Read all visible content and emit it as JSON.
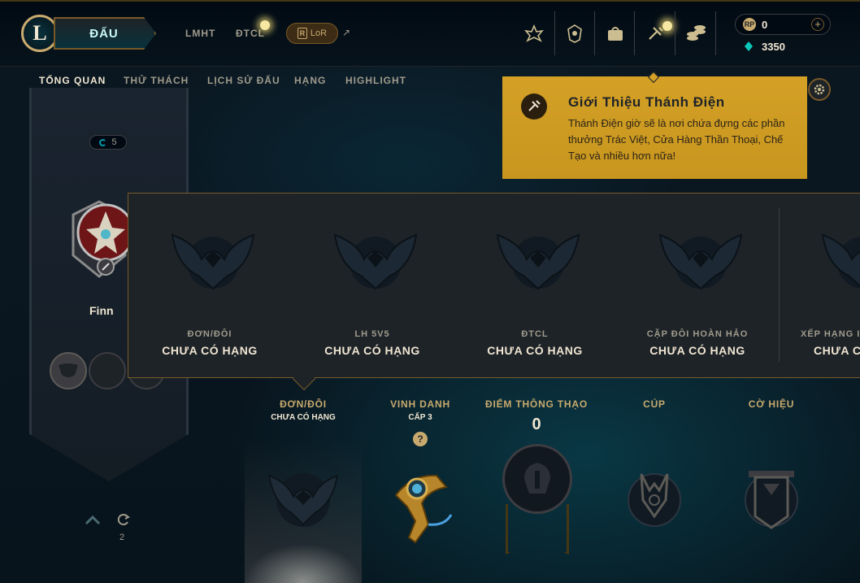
{
  "topnav": {
    "logo_letter": "L",
    "play_label": "ĐẤU",
    "links": [
      "LMHT",
      "ĐTCL"
    ],
    "lor_label": "LoR",
    "lor_letter": "R",
    "external_arrow": "↗",
    "icons": [
      "profile-crest-icon",
      "collection-icon",
      "loot-bag-icon",
      "sanctum-icon",
      "store-icon"
    ]
  },
  "currency": {
    "rp_symbol": "RP",
    "rp_value": "0",
    "plus": "+",
    "be_value": "3350"
  },
  "subnav": {
    "tabs": [
      "TỔNG QUAN",
      "THỬ THÁCH",
      "LỊCH SỬ ĐẤU",
      "HẠNG",
      "HIGHLIGHT"
    ],
    "active_tab": "TỔNG QUAN"
  },
  "profile": {
    "level": "5",
    "name": "Finn",
    "bottom_count": "2"
  },
  "tooltip": {
    "title": "Giới Thiệu Thánh Điện",
    "body": "Thánh Điện giờ sẽ là nơi chứa đựng các phần thưởng Trác Việt, Cửa Hàng Thần Thoại, Chế Tạo và nhiều hơn nữa!"
  },
  "ranked_flyout": {
    "queues": [
      {
        "name": "ĐƠN/ĐÔI",
        "rank": "CHƯA CÓ HẠNG"
      },
      {
        "name": "LH 5V5",
        "rank": "CHƯA CÓ HẠNG"
      },
      {
        "name": "ĐTCL",
        "rank": "CHƯA CÓ HẠNG"
      },
      {
        "name": "CẶP ĐÔI HOÀN HẢO",
        "rank": "CHƯA CÓ HẠNG"
      },
      {
        "name": "XẾP HẠNG I",
        "rank": "CHƯA C"
      }
    ]
  },
  "stats": {
    "ranked": {
      "title": "ĐƠN/ĐÔI",
      "sub": "CHƯA CÓ HẠNG"
    },
    "honor": {
      "title": "VINH DANH",
      "sub": "CẤP 3",
      "help": "?"
    },
    "mastery": {
      "title": "ĐIỂM THÔNG THẠO",
      "value": "0"
    },
    "trophy": {
      "title": "CÚP"
    },
    "banner": {
      "title": "CỜ HIỆU"
    }
  },
  "colors": {
    "gold": "#c8aa6e",
    "tooltip_bg": "#c8961e",
    "teal_accent": "#0ac8b9",
    "panel_bg": "#1e2328"
  }
}
